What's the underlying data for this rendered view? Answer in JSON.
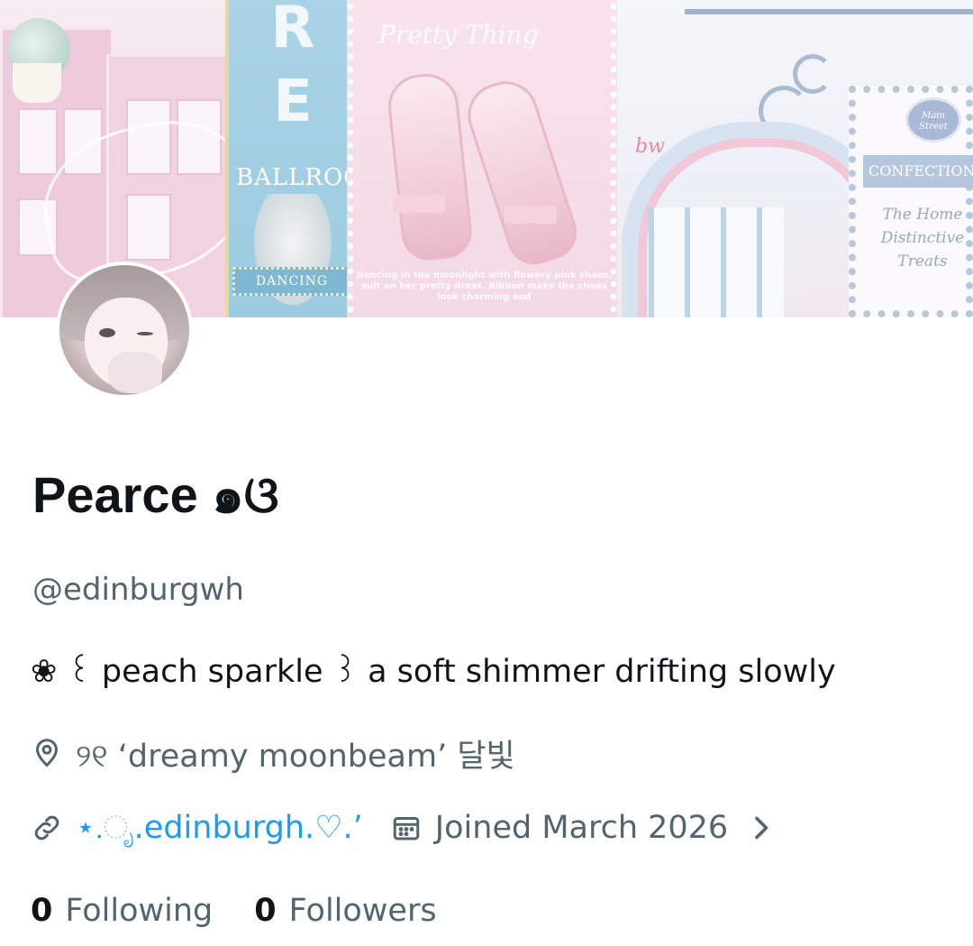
{
  "banner": {
    "panel_left": {
      "sign_letters": [
        "R",
        "E"
      ],
      "sign_text": "BALLROO",
      "marquee_text": "DANCING"
    },
    "panel_middle": {
      "title": "Pretty Thing",
      "caption": "Dancing in the moonlight with flowery pink shoes, suit on her pretty dress. Ribbon make the shoes look charming and"
    },
    "panel_right": {
      "medallion": "Main Street",
      "sign_strip": "CONFECTIONE",
      "sign_script": "The Home Distinctive Treats"
    }
  },
  "profile": {
    "display_name": "Pearce ๑ଓ",
    "handle": "@edinburgwh",
    "bio": "❀ ꒰ peach sparkle ꒱ a soft shimmer drifting slowly",
    "location": "୨୧ ‘dreamy moonbeam’ 달빛",
    "website": "⋆.ೃ.edinburgh.♡.’",
    "joined": "Joined March 2026",
    "following_count": "0",
    "following_label": "Following",
    "followers_count": "0",
    "followers_label": "Followers"
  },
  "colors": {
    "name_text": "#0f1419",
    "secondary_text": "#536471",
    "link": "#1d9bf0",
    "background": "#ffffff"
  },
  "icons": {
    "location": "location-pin-icon",
    "website": "link-icon",
    "joined": "calendar-icon",
    "expand": "chevron-right-icon"
  }
}
